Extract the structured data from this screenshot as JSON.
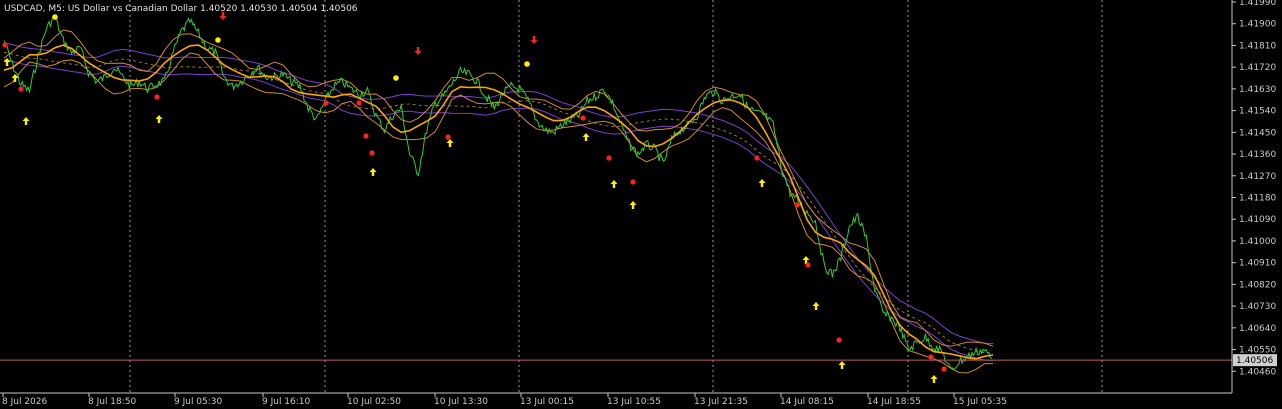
{
  "header": {
    "title": "USDCAD, M5:  US Dollar vs Canadian Dollar  1.40520 1.40530 1.40504 1.40506"
  },
  "colors": {
    "background": "#000000",
    "price_line": "#32cd32",
    "smooth_line": "#ffa500",
    "band": "#d18b2a",
    "ma_slow": "#7b3fd0",
    "current_price_line": "#c85a5a",
    "grid": "#9a9a9a",
    "axis": "#c8c8c8",
    "arrow_up": "#ffee00",
    "arrow_down": "#ff2020",
    "dot_red": "#ff2020",
    "dot_yellow": "#ffee00",
    "price_tag_bg": "#d0d0d0"
  },
  "chart_data": {
    "type": "line",
    "symbol": "USDCAD",
    "timeframe": "M5",
    "ylim": [
      1.4037,
      1.4199
    ],
    "y_ticks": [
      "1.41990",
      "1.41900",
      "1.41810",
      "1.41720",
      "1.41630",
      "1.41540",
      "1.41450",
      "1.41360",
      "1.41270",
      "1.41180",
      "1.41090",
      "1.41000",
      "1.40910",
      "1.40820",
      "1.40730",
      "1.40640",
      "1.40550",
      "1.40460"
    ],
    "current_price": "1.40506",
    "x_labels": [
      "8 Jul 2026",
      "8 Jul 18:50",
      "9 Jul 05:30",
      "9 Jul 16:10",
      "10 Jul 02:50",
      "10 Jul 13:30",
      "13 Jul 00:15",
      "13 Jul 10:55",
      "13 Jul 21:35",
      "14 Jul 08:15",
      "14 Jul 18:55",
      "15 Jul 05:35"
    ],
    "grid": "vertical dotted",
    "series": [
      {
        "values": [
          1.4183,
          1.4173,
          1.4165,
          1.4162,
          1.4176,
          1.4188,
          1.4193,
          1.4183,
          1.4178,
          1.418,
          1.417,
          1.4166,
          1.4168,
          1.4172,
          1.4168,
          1.4164,
          1.4166,
          1.4163,
          1.4165,
          1.4166,
          1.4178,
          1.4187,
          1.4191,
          1.4186,
          1.418,
          1.4178,
          1.4168,
          1.4164,
          1.4166,
          1.4169,
          1.4172,
          1.4168,
          1.4168,
          1.4169,
          1.4166,
          1.4164,
          1.4155,
          1.415,
          1.4158,
          1.4164,
          1.4166,
          1.4163,
          1.4161,
          1.4162,
          1.4152,
          1.4146,
          1.4152,
          1.4155,
          1.4136,
          1.4128,
          1.4146,
          1.4157,
          1.416,
          1.4165,
          1.417,
          1.4169,
          1.4166,
          1.416,
          1.4155,
          1.4161,
          1.4164,
          1.4163,
          1.4158,
          1.415,
          1.4146,
          1.4145,
          1.4148,
          1.415,
          1.4152,
          1.4158,
          1.416,
          1.4163,
          1.4157,
          1.4148,
          1.414,
          1.4136,
          1.414,
          1.4138,
          1.4132,
          1.4142,
          1.4146,
          1.4148,
          1.4152,
          1.416,
          1.4162,
          1.4158,
          1.416,
          1.4161,
          1.4155,
          1.4153,
          1.4152,
          1.4148,
          1.413,
          1.412,
          1.4116,
          1.4112,
          1.4108,
          1.409,
          1.4086,
          1.4093,
          1.4106,
          1.411,
          1.4101,
          1.408,
          1.407,
          1.4068,
          1.4064,
          1.4055,
          1.4058,
          1.406,
          1.4056,
          1.4054,
          1.4046,
          1.405,
          1.4052,
          1.4054,
          1.4055,
          1.405
        ],
        "type": "price"
      }
    ]
  }
}
